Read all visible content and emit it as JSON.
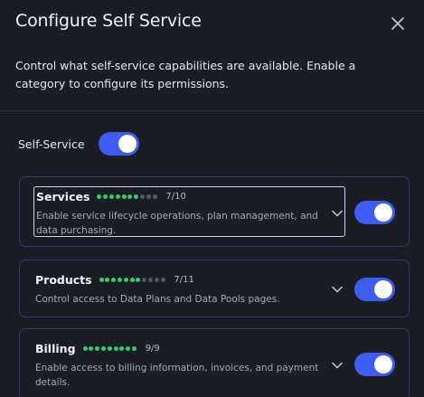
{
  "modal": {
    "title": "Configure Self Service",
    "description": "Control what self-service capabilities are available. Enable a category to configure its permissions.",
    "close_icon": "close-icon"
  },
  "self_service": {
    "label": "Self-Service",
    "enabled": true
  },
  "categories": [
    {
      "title": "Services",
      "enabled_count": 7,
      "total": 10,
      "count_label": "7/10",
      "description": "Enable service lifecycle operations, plan management, and data purchasing.",
      "enabled": true,
      "focused": true
    },
    {
      "title": "Products",
      "enabled_count": 7,
      "total": 11,
      "count_label": "7/11",
      "description": "Control access to Data Plans and Data Pools pages.",
      "enabled": true,
      "focused": false
    },
    {
      "title": "Billing",
      "enabled_count": 9,
      "total": 9,
      "count_label": "9/9",
      "description": "Enable access to billing information, invoices, and payment details.",
      "enabled": true,
      "focused": false
    }
  ],
  "colors": {
    "accent": "#3e5bf2",
    "dot_on": "#2fd06c",
    "dot_off": "#55575f",
    "card_border": "#2d3a72",
    "background": "#1b1d24"
  },
  "icons": {
    "close": "close-icon",
    "chevron": "chevron-down-icon"
  }
}
